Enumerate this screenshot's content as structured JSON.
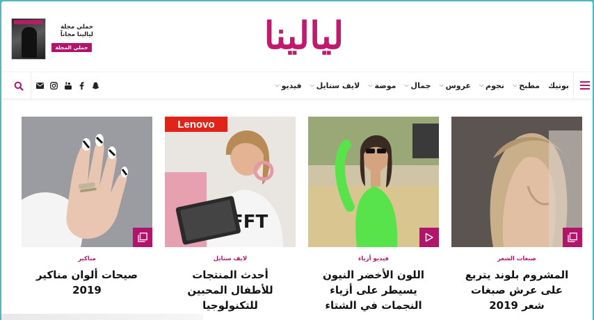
{
  "colors": {
    "brand": "#b3146b",
    "logo": "#c01a6e",
    "outer": "#4fb6c6"
  },
  "promo": {
    "line1": "حملي مجلة",
    "line2": "ليالينا مجاناً",
    "button": "حملي المجلة مجاناً"
  },
  "logo_text": "ليالينا",
  "nav": {
    "menu_icon": "hamburger-icon",
    "items": [
      {
        "label": "فيديو",
        "has_dropdown": true
      },
      {
        "label": "لايف ستايل",
        "has_dropdown": true
      },
      {
        "label": "موضة",
        "has_dropdown": true
      },
      {
        "label": "جمال",
        "has_dropdown": true
      },
      {
        "label": "عروس",
        "has_dropdown": true
      },
      {
        "label": "نجوم",
        "has_dropdown": true
      },
      {
        "label": "مطبخ",
        "has_dropdown": true
      },
      {
        "label": "بوتيك",
        "has_dropdown": false
      }
    ],
    "social_icons": [
      "snapchat-icon",
      "facebook-icon",
      "youtube-icon",
      "instagram-icon",
      "email-icon"
    ],
    "search_icon": "search-icon"
  },
  "cards": [
    {
      "category": "صبغات الشعر",
      "title": "المشروم بلوند يتربع على عرش صبغات شعر 2019",
      "badge": "gallery-icon"
    },
    {
      "category": "فيديو أزياء",
      "title": "اللون الأخضر النيون يسيطر على أزياء النجمات في الشتاء",
      "badge": "play-icon"
    },
    {
      "category": "لايف ستايل",
      "title": "أحدث المنتجات للأطفال المحبين للتكنولوجيا",
      "badge": "gallery-icon",
      "image_logo": "Lenovo"
    },
    {
      "category": "مناكير",
      "title": "صيحات ألوان مناكير 2019",
      "badge": "gallery-icon"
    }
  ]
}
